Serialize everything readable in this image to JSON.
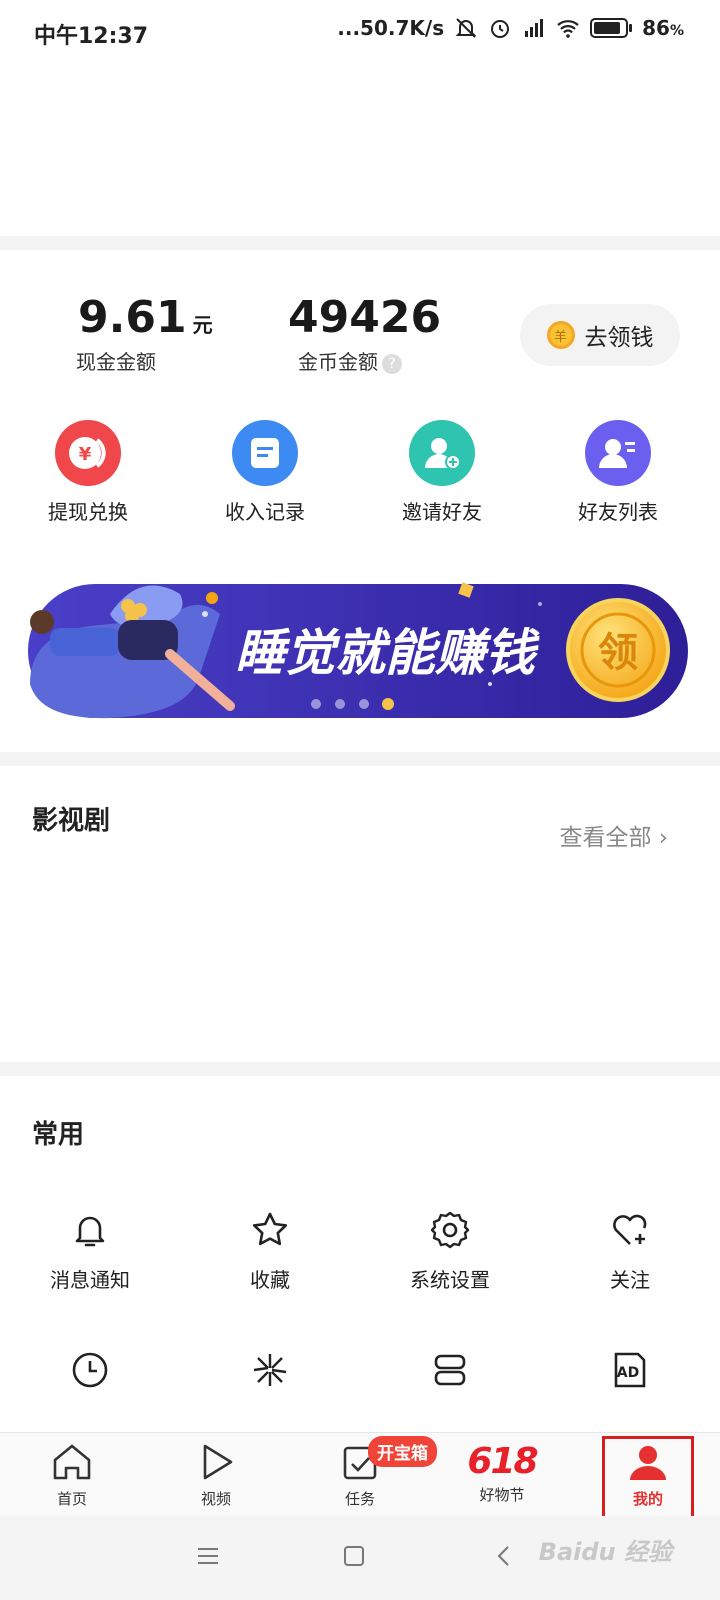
{
  "status_bar": {
    "time": "中午12:37",
    "network_speed": "...50.7K/s",
    "battery": "86",
    "battery_unit": "%",
    "battery_level": 0.86
  },
  "wallet": {
    "cash_value": "9.61",
    "cash_unit": "元",
    "cash_label": "现金金额",
    "coin_value": "49426",
    "coin_label": "金币金额",
    "help_glyph": "?",
    "coin_glyph": "羊",
    "get_money_label": "去领钱"
  },
  "quick_actions": [
    {
      "label": "提现兑换",
      "icon": "exchange-yen-icon",
      "color": "#f0474b"
    },
    {
      "label": "收入记录",
      "icon": "income-record-icon",
      "color": "#3d8bf2"
    },
    {
      "label": "邀请好友",
      "icon": "invite-friend-icon",
      "color": "#2ec4b0"
    },
    {
      "label": "好友列表",
      "icon": "friend-list-icon",
      "color": "#6b5ff0"
    }
  ],
  "banner": {
    "slogan": "睡觉就能赚钱",
    "button_glyph": "领",
    "dots": 4,
    "active_dot": 3
  },
  "movies": {
    "title": "影视剧",
    "see_all": "查看全部 ›"
  },
  "common": {
    "title": "常用",
    "items": [
      {
        "label": "消息通知",
        "icon": "bell-icon"
      },
      {
        "label": "收藏",
        "icon": "star-icon"
      },
      {
        "label": "系统设置",
        "icon": "gear-icon"
      },
      {
        "label": "关注",
        "icon": "heart-plus-icon"
      }
    ],
    "row2_icons": [
      "clock-icon",
      "sparkle-icon",
      "layers-icon",
      "ad-icon"
    ]
  },
  "bottom_nav": {
    "items": [
      {
        "label": "首页",
        "icon": "home-icon"
      },
      {
        "label": "视频",
        "icon": "play-icon"
      },
      {
        "label": "任务",
        "icon": "task-icon"
      },
      {
        "label": "好物节",
        "icon": "618-logo"
      },
      {
        "label": "我的",
        "icon": "user-icon"
      }
    ],
    "badge": "开宝箱",
    "festival_mark": "618",
    "active_index": 4
  },
  "colors": {
    "accent_red": "#e63030",
    "banner_purple": "#3b2fb0"
  },
  "watermark": "Baidu 经验"
}
